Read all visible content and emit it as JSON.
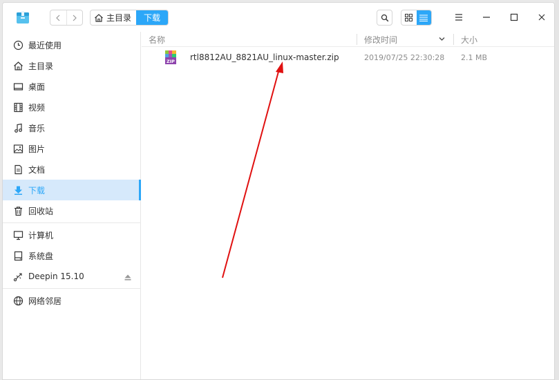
{
  "breadcrumb": {
    "home": "主目录",
    "current": "下载"
  },
  "sidebar": {
    "items": [
      {
        "label": "最近使用",
        "icon": "clock-icon"
      },
      {
        "label": "主目录",
        "icon": "home-icon"
      },
      {
        "label": "桌面",
        "icon": "desktop-icon"
      },
      {
        "label": "视频",
        "icon": "film-icon"
      },
      {
        "label": "音乐",
        "icon": "music-icon"
      },
      {
        "label": "图片",
        "icon": "image-icon"
      },
      {
        "label": "文档",
        "icon": "document-icon"
      },
      {
        "label": "下载",
        "icon": "download-icon",
        "active": true
      },
      {
        "label": "回收站",
        "icon": "trash-icon"
      },
      {
        "label": "计算机",
        "icon": "computer-icon"
      },
      {
        "label": "系统盘",
        "icon": "disk-icon"
      },
      {
        "label": "Deepin 15.10",
        "icon": "usb-icon"
      },
      {
        "label": "网络邻居",
        "icon": "network-icon"
      }
    ]
  },
  "columns": {
    "name": "名称",
    "modified": "修改时间",
    "size": "大小"
  },
  "files": [
    {
      "name": "rtl8812AU_8821AU_linux-master.zip",
      "modified": "2019/07/25 22:30:28",
      "size": "2.1 MB",
      "icon": "zip-file-icon"
    }
  ],
  "colors": {
    "accent": "#2ca7f8",
    "selection": "#d6e9fb",
    "annotation_arrow": "#e01010"
  }
}
